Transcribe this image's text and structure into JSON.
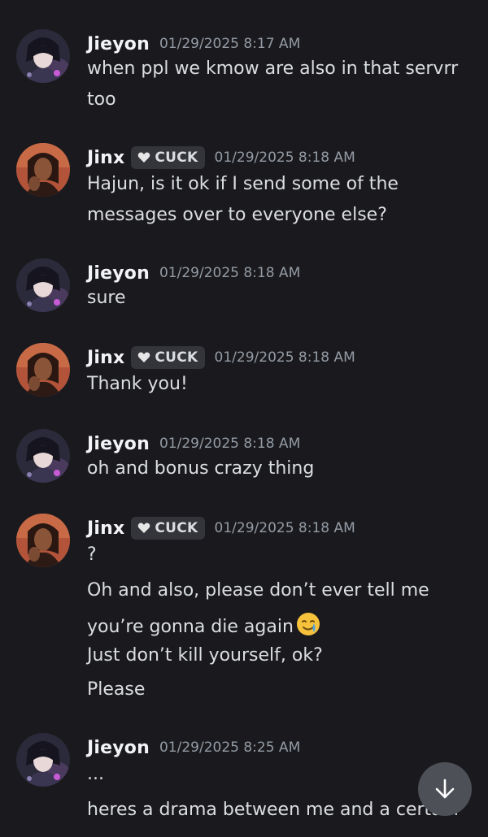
{
  "messages": [
    {
      "user": "Jieyon",
      "tag": "",
      "timestamp": "01/29/2025 8:17 AM",
      "avatar": "jieyon",
      "lines": [
        "when ppl we kmow are also in that servrr",
        "too"
      ]
    },
    {
      "user": "Jinx",
      "tag": "CUCK",
      "timestamp": "01/29/2025 8:18 AM",
      "avatar": "jinx",
      "lines": [
        "Hajun, is it ok if I send some of the",
        "messages over to everyone else?"
      ]
    },
    {
      "user": "Jieyon",
      "tag": "",
      "timestamp": "01/29/2025 8:18 AM",
      "avatar": "jieyon",
      "lines": [
        "sure"
      ]
    },
    {
      "user": "Jinx",
      "tag": "CUCK",
      "timestamp": "01/29/2025 8:18 AM",
      "avatar": "jinx",
      "lines": [
        "Thank you!"
      ]
    },
    {
      "user": "Jieyon",
      "tag": "",
      "timestamp": "01/29/2025 8:18 AM",
      "avatar": "jieyon",
      "lines": [
        "oh and bonus crazy thing"
      ]
    },
    {
      "user": "Jinx",
      "tag": "CUCK",
      "timestamp": "01/29/2025 8:18 AM",
      "avatar": "jinx",
      "lines": [
        "?",
        "Oh and also, please don’t ever tell me",
        "you’re gonna die again",
        "Just don’t kill yourself, ok?",
        "Please"
      ]
    },
    {
      "user": "Jieyon",
      "tag": "",
      "timestamp": "01/29/2025 8:25 AM",
      "avatar": "jieyon",
      "lines": [
        "...",
        "heres a drama between me and a certain"
      ]
    }
  ],
  "icons": {
    "tag_icon": "heart-icon",
    "emoji": "crying-smile-emoji",
    "scroll_button": "arrow-down-icon"
  },
  "colors": {
    "background": "#1a1a1e",
    "username": "#f2f3f5",
    "text": "#dbdee1",
    "timestamp": "#949ba4",
    "tag_bg": "#34343b",
    "scroll_button_bg": "#4e5058"
  }
}
